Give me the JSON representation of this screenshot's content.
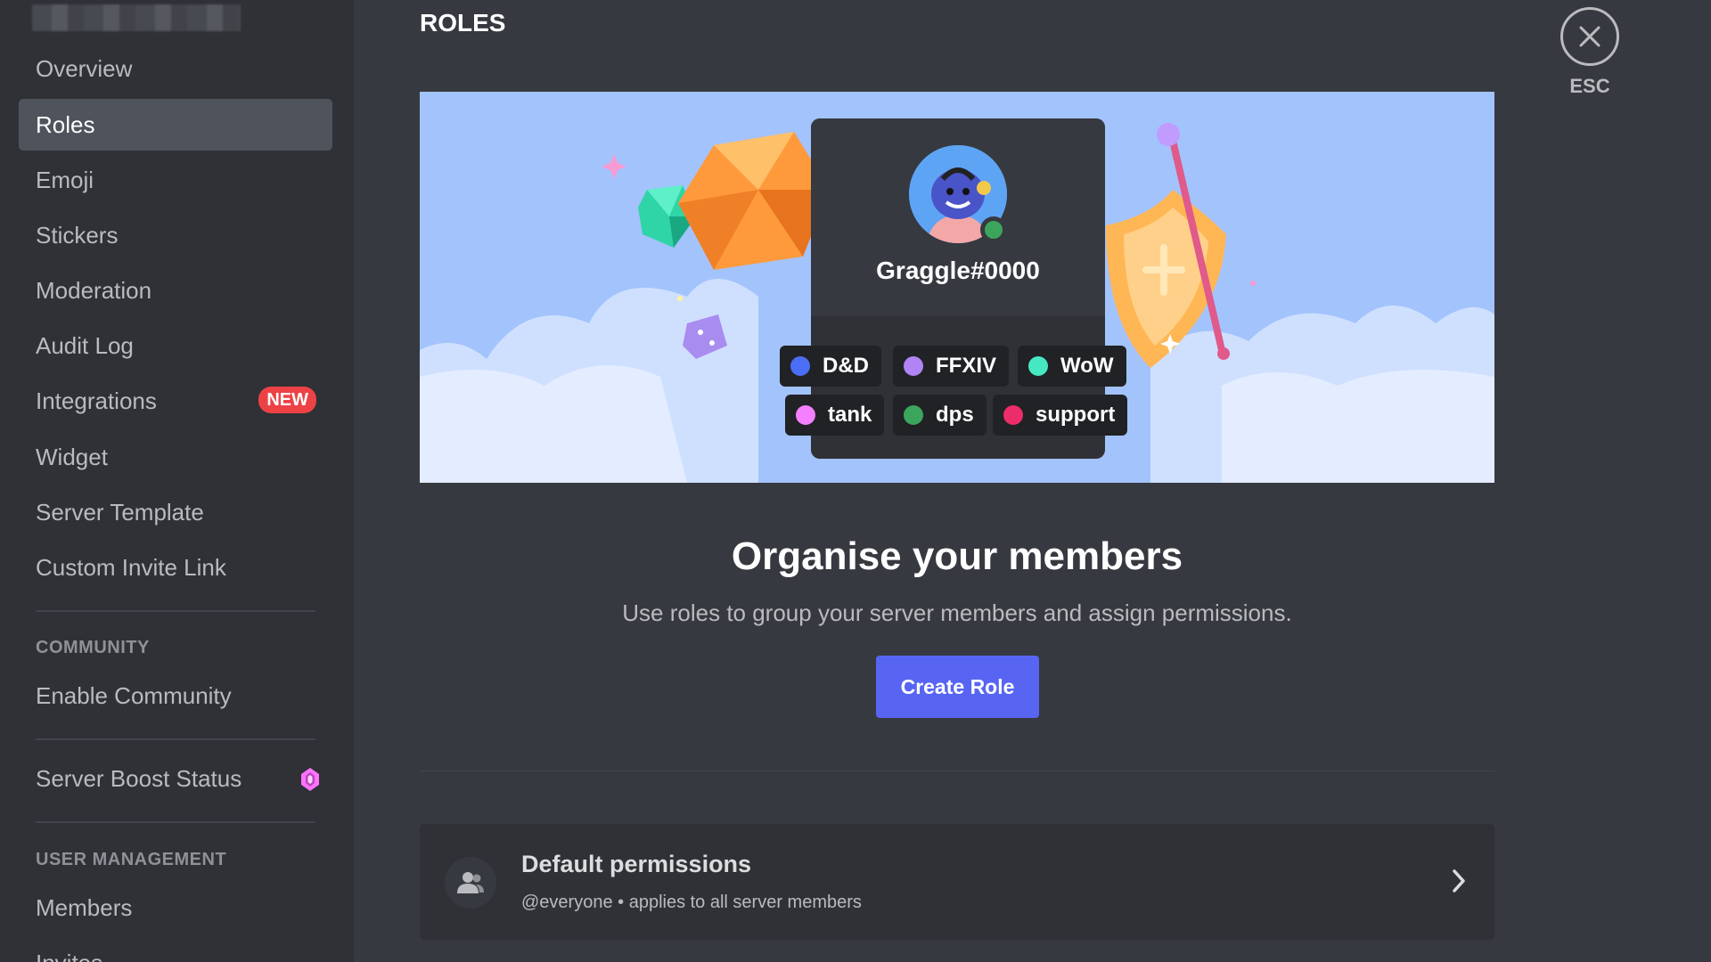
{
  "sidebar": {
    "items": [
      {
        "label": "Overview",
        "selected": false
      },
      {
        "label": "Roles",
        "selected": true
      },
      {
        "label": "Emoji",
        "selected": false
      },
      {
        "label": "Stickers",
        "selected": false
      },
      {
        "label": "Moderation",
        "selected": false
      },
      {
        "label": "Audit Log",
        "selected": false
      },
      {
        "label": "Integrations",
        "badge": "NEW"
      },
      {
        "label": "Widget",
        "selected": false
      },
      {
        "label": "Server Template",
        "selected": false
      },
      {
        "label": "Custom Invite Link",
        "selected": false
      }
    ],
    "community_header": "COMMUNITY",
    "community_items": [
      {
        "label": "Enable Community"
      }
    ],
    "boost_item": {
      "label": "Server Boost Status",
      "icon": "boost-gem-icon"
    },
    "user_mgmt_header": "USER MANAGEMENT",
    "user_mgmt_items": [
      {
        "label": "Members"
      },
      {
        "label": "Invites"
      }
    ]
  },
  "header": {
    "title": "ROLES"
  },
  "close": {
    "label": "ESC",
    "icon": "close-icon"
  },
  "hero": {
    "username": "Graggle#0000",
    "status_color": "#3ba55c",
    "roles": [
      {
        "name": "D&D",
        "color": "#4c6ef5"
      },
      {
        "name": "FFXIV",
        "color": "#b084f5"
      },
      {
        "name": "WoW",
        "color": "#46e8c1"
      },
      {
        "name": "tank",
        "color": "#f47fff"
      },
      {
        "name": "dps",
        "color": "#3ba55c"
      },
      {
        "name": "support",
        "color": "#ed2d6a"
      }
    ]
  },
  "main": {
    "headline": "Organise your members",
    "subline": "Use roles to group your server members and assign permissions.",
    "create_button": "Create Role"
  },
  "default_permissions": {
    "title": "Default permissions",
    "subtitle": "@everyone • applies to all server members",
    "icon": "members-icon"
  },
  "colors": {
    "accent": "#5865f2",
    "badge": "#ed4245",
    "background": "#36393f",
    "sidebar": "#2f3136"
  }
}
